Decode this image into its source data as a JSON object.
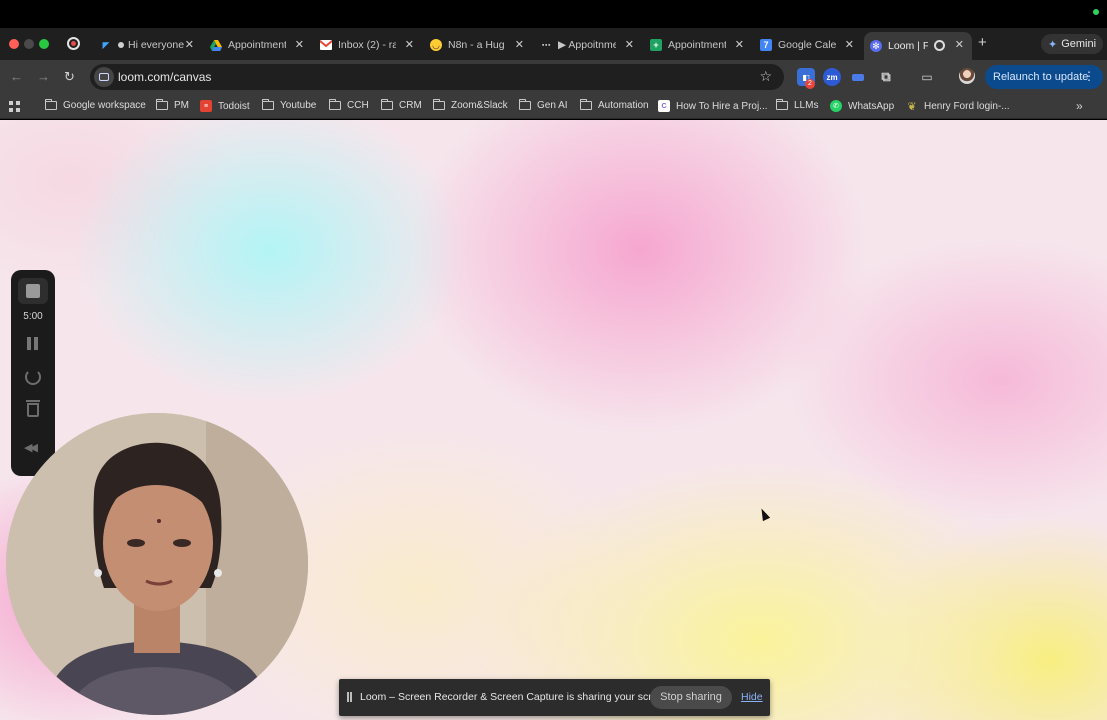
{
  "browser": {
    "tabs": [
      {
        "title": "Hi everyone",
        "icon": "vscode-icon"
      },
      {
        "title": "Appointment",
        "icon": "google-drive-icon"
      },
      {
        "title": "Inbox (2) - ra",
        "icon": "gmail-icon"
      },
      {
        "title": "N8n - a Hug",
        "icon": "hugging-face-icon"
      },
      {
        "title": "▶ Appoitnme",
        "icon": "n8n-icon"
      },
      {
        "title": "Appointment",
        "icon": "google-sheets-icon"
      },
      {
        "title": "Google Calen",
        "icon": "google-calendar-icon"
      },
      {
        "title": "Loom | Fr",
        "icon": "loom-icon",
        "active": true
      }
    ],
    "gemini_label": "Gemini",
    "url": "loom.com/canvas",
    "relaunch_label": "Relaunch to update",
    "extension_badge": "2",
    "bookmarks": [
      {
        "label": "Google workspace",
        "type": "folder"
      },
      {
        "label": "PM",
        "type": "folder"
      },
      {
        "label": "Todoist",
        "type": "todoist"
      },
      {
        "label": "Youtube",
        "type": "folder"
      },
      {
        "label": "CCH",
        "type": "folder"
      },
      {
        "label": "CRM",
        "type": "folder"
      },
      {
        "label": "Zoom&Slack",
        "type": "folder"
      },
      {
        "label": "Gen AI",
        "type": "folder"
      },
      {
        "label": "Automation",
        "type": "folder"
      },
      {
        "label": "How To Hire a Proj...",
        "type": "clickup"
      },
      {
        "label": "LLMs",
        "type": "folder"
      },
      {
        "label": "WhatsApp",
        "type": "whatsapp"
      },
      {
        "label": "Henry Ford login-...",
        "type": "henryford"
      }
    ]
  },
  "loom": {
    "timer": "5:00",
    "share_message": "Loom – Screen Recorder & Screen Capture is sharing your screen.",
    "stop_sharing_label": "Stop sharing",
    "hide_label": "Hide"
  },
  "colors": {
    "loom_rail": "#1b1b1b",
    "relaunch_button": "#0b4a8c",
    "hide_link": "#8ab4f8"
  }
}
